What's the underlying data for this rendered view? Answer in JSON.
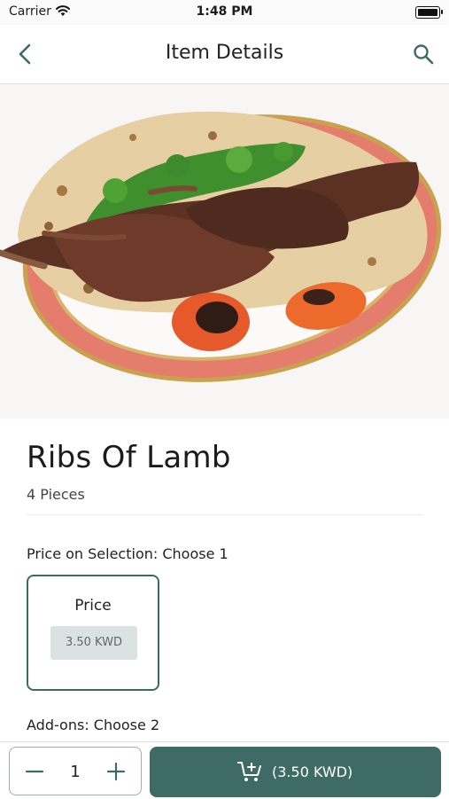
{
  "status_bar": {
    "carrier": "Carrier",
    "time": "1:48 PM",
    "icons": [
      "wifi-icon",
      "battery-icon"
    ]
  },
  "nav": {
    "title": "Item Details",
    "icons": [
      "back-icon",
      "search-icon"
    ]
  },
  "item": {
    "name": "Ribs Of Lamb",
    "description": "4 Pieces"
  },
  "sections": {
    "price_selection_title": "Price on Selection: Choose 1",
    "addons_title": "Add-ons: Choose 2"
  },
  "price_option": {
    "label": "Price",
    "value": "3.50 KWD",
    "selected": true
  },
  "bottom_bar": {
    "quantity": "1",
    "add_to_cart_label": "(3.50 KWD)",
    "icons": [
      "minus-icon",
      "plus-icon",
      "cart-add-icon"
    ]
  },
  "colors": {
    "accent": "#3e6b66",
    "chip_bg": "#dbe3e2",
    "chip_text": "#5d6b69"
  }
}
